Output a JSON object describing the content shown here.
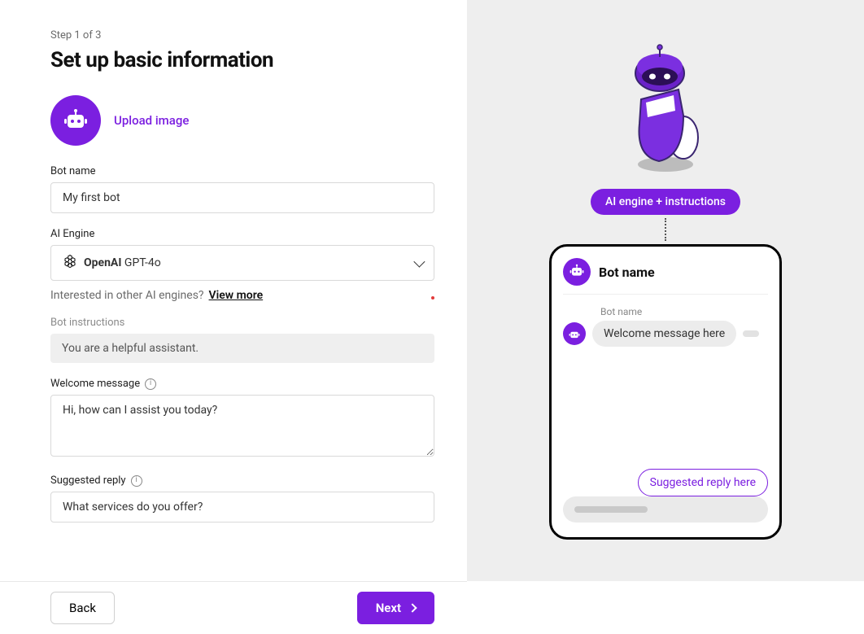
{
  "wizard": {
    "step_text": "Step 1 of 3",
    "title": "Set up basic information"
  },
  "upload": {
    "link_label": "Upload image"
  },
  "fields": {
    "bot_name": {
      "label": "Bot name",
      "value": "My first bot"
    },
    "ai_engine": {
      "label": "AI Engine",
      "provider": "OpenAI",
      "model": "GPT-4o",
      "hint_prefix": "Interested in other AI engines?",
      "hint_link": "View more"
    },
    "instructions": {
      "label": "Bot instructions",
      "value": "You are a helpful assistant."
    },
    "welcome": {
      "label": "Welcome message",
      "value": "Hi, how can I assist you today?"
    },
    "suggested": {
      "label": "Suggested reply",
      "value": "What services do you offer?"
    }
  },
  "footer": {
    "back": "Back",
    "next": "Next"
  },
  "preview": {
    "pill": "AI engine + instructions",
    "header_title": "Bot name",
    "message_sender": "Bot name",
    "welcome_bubble": "Welcome message here",
    "suggested_bubble": "Suggested reply here"
  }
}
